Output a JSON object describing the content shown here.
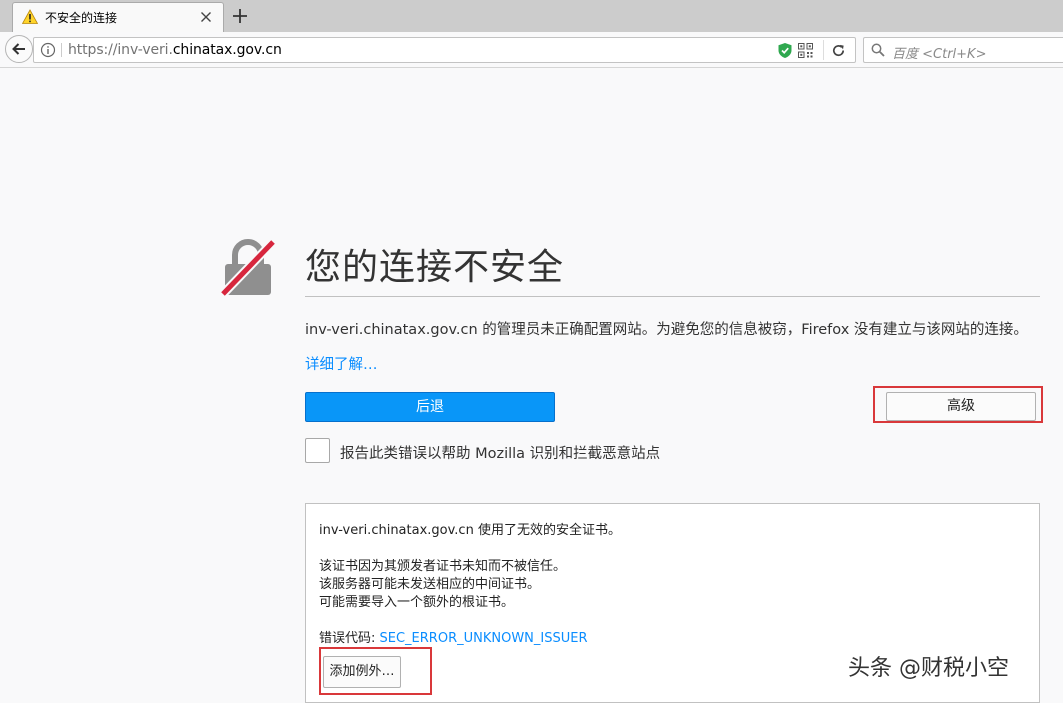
{
  "browser": {
    "tab_title": "不安全的连接",
    "url_prefix": "https://inv-veri.",
    "url_domain": "chinatax.gov.cn",
    "search_placeholder": "百度 <Ctrl+K>"
  },
  "page": {
    "title": "您的连接不安全",
    "description": "inv-veri.chinatax.gov.cn 的管理员未正确配置网站。为避免您的信息被窃，Firefox 没有建立与该网站的连接。",
    "learn_more": "详细了解…",
    "back_button": "后退",
    "advanced_button": "高级",
    "report_label": "报告此类错误以帮助 Mozilla 识别和拦截恶意站点"
  },
  "advanced_panel": {
    "line1": "inv-veri.chinatax.gov.cn 使用了无效的安全证书。",
    "line2": "该证书因为其颁发者证书未知而不被信任。",
    "line3": "该服务器可能未发送相应的中间证书。",
    "line4": "可能需要导入一个额外的根证书。",
    "error_code_label": "错误代码: ",
    "error_code": "SEC_ERROR_UNKNOWN_ISSUER",
    "add_exception_button": "添加例外…"
  },
  "watermark": "头条 @财税小空",
  "colors": {
    "accent_blue": "#0996f8",
    "link_blue": "#0a8dff",
    "highlight_red": "#d9383a",
    "lock_strike_red": "#d7263d"
  }
}
